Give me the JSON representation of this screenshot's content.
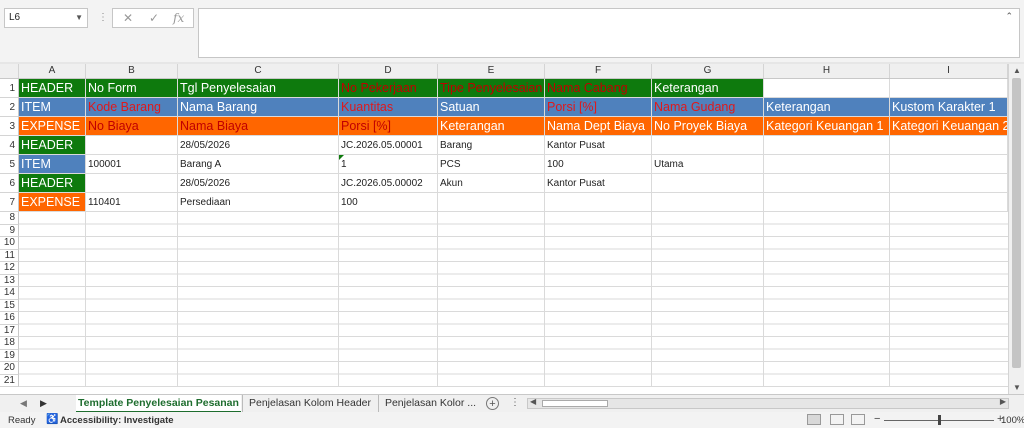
{
  "formula_bar": {
    "name_box": "L6",
    "cancel_icon": "✕",
    "enter_icon": "✓",
    "fx_label": "fx",
    "value": ""
  },
  "columns": [
    "A",
    "B",
    "C",
    "D",
    "E",
    "F",
    "G",
    "H",
    "I"
  ],
  "rows": [
    "1",
    "2",
    "3",
    "4",
    "5",
    "6",
    "7",
    "8",
    "9",
    "10",
    "11",
    "12",
    "13",
    "14",
    "15",
    "16",
    "17",
    "18",
    "19",
    "20",
    "21"
  ],
  "cells": {
    "r1": [
      "HEADER",
      "No Form",
      "Tgl Penyelesaian",
      "No Pekerjaan",
      "Tipe Penyelesaian",
      "Nama Cabang",
      "Keterangan"
    ],
    "r2": [
      "ITEM",
      "Kode Barang",
      "Nama Barang",
      "Kuantitas",
      "Satuan",
      "Porsi [%]",
      "Nama Gudang",
      "Keterangan",
      "Kustom Karakter 1"
    ],
    "r3": [
      "EXPENSE",
      "No Biaya",
      "Nama Biaya",
      "Porsi [%]",
      "Keterangan",
      "Nama Dept Biaya",
      "No Proyek Biaya",
      "Kategori Keuangan 1",
      "Kategori Keuangan 2"
    ],
    "r4": [
      "HEADER",
      "",
      "28/05/2026",
      "JC.2026.05.00001",
      "Barang",
      "Kantor Pusat"
    ],
    "r5": [
      "ITEM",
      "100001",
      "Barang A",
      "1",
      "PCS",
      "100",
      "Utama"
    ],
    "r6": [
      "HEADER",
      "",
      "28/05/2026",
      "JC.2026.05.00002",
      "Akun",
      "Kantor Pusat"
    ],
    "r7": [
      "EXPENSE",
      "110401",
      "Persediaan",
      "100"
    ]
  },
  "colors": {
    "header_green": "#0e7a0d",
    "item_blue": "#4f81bd",
    "expense_orange": "#ff6600",
    "required_red": "#e0191b",
    "active_tab": "#1e6d2e"
  },
  "sheet_tabs": [
    {
      "label": "Template Penyelesaian Pesanan",
      "active": true
    },
    {
      "label": "Penjelasan Kolom Header",
      "active": false
    },
    {
      "label": "Penjelasan Kolor ...",
      "active": false
    }
  ],
  "status_bar": {
    "ready": "Ready",
    "accessibility": "Accessibility: Investigate",
    "zoom": "100%"
  }
}
